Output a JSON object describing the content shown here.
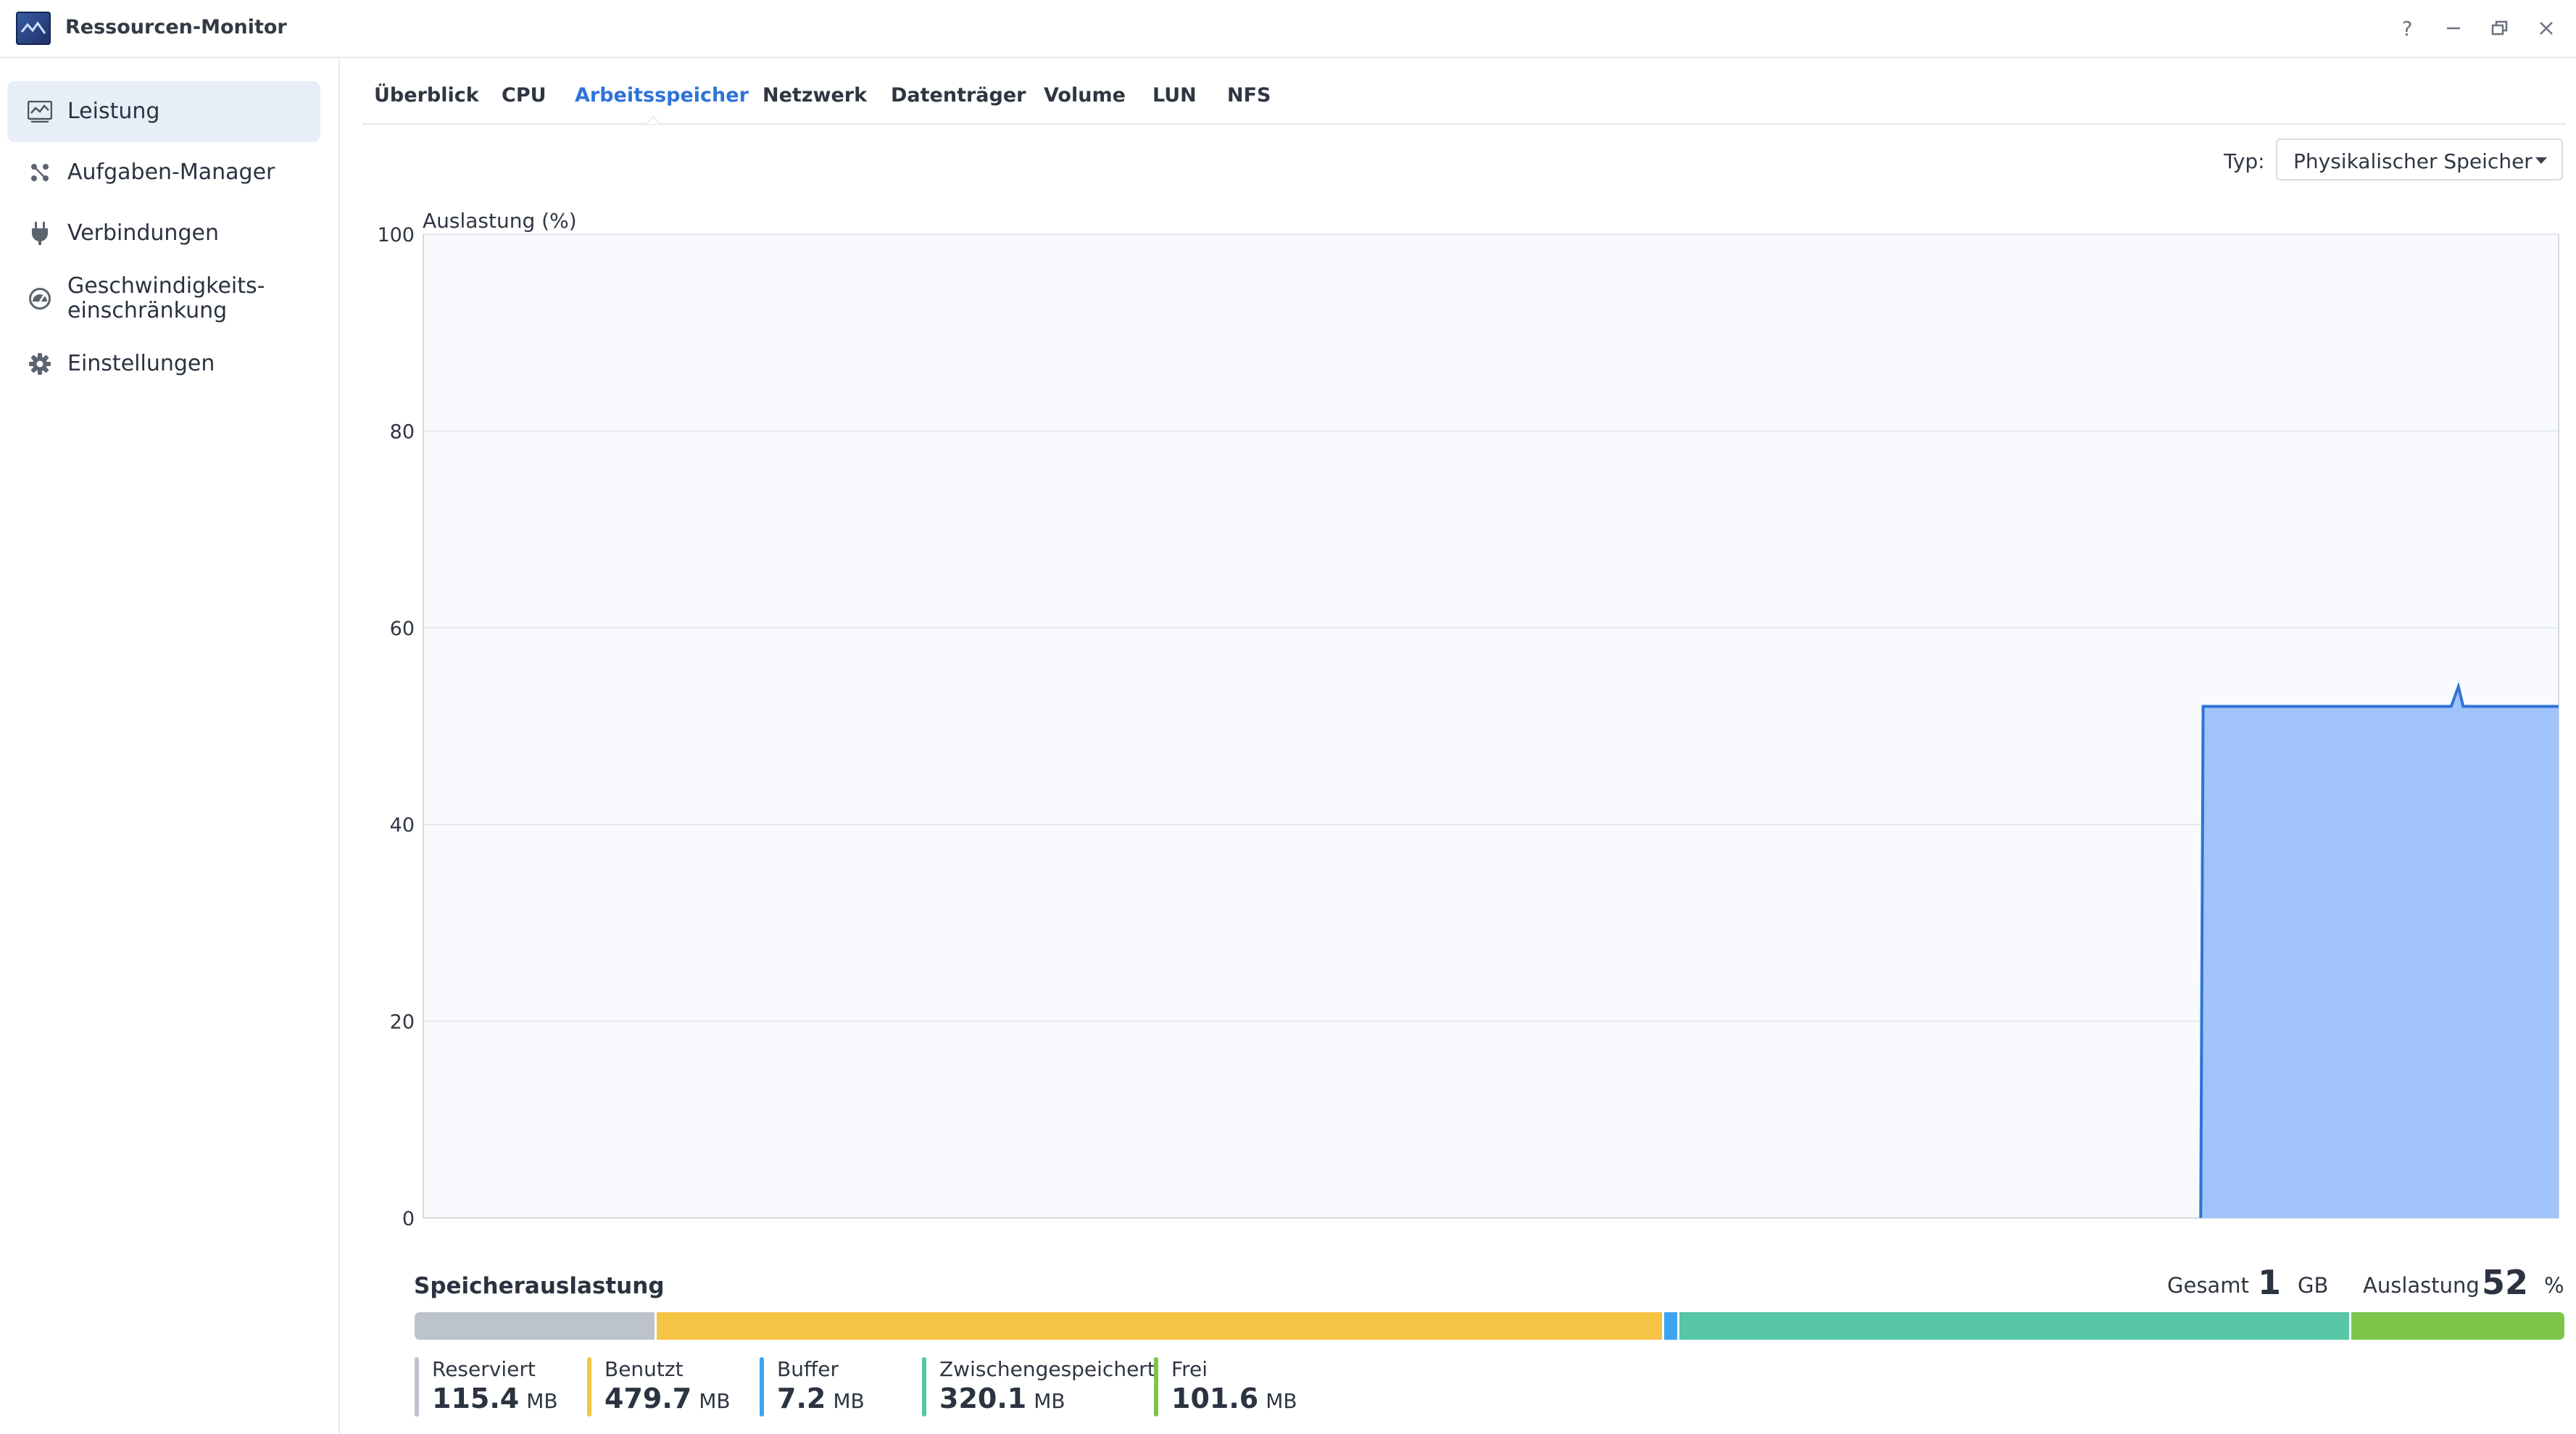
{
  "window": {
    "title": "Ressourcen-Monitor"
  },
  "sidebar": {
    "items": [
      {
        "label": "Leistung",
        "icon": "performance-icon",
        "active": true
      },
      {
        "label": "Aufgaben-Manager",
        "icon": "task-manager-icon"
      },
      {
        "label": "Verbindungen",
        "icon": "plug-icon"
      },
      {
        "label": "Geschwindigkeits-\neinschränkung",
        "icon": "speed-gauge-icon"
      },
      {
        "label": "Einstellungen",
        "icon": "gear-icon"
      }
    ]
  },
  "tabs": [
    {
      "label": "Überblick"
    },
    {
      "label": "CPU"
    },
    {
      "label": "Arbeitsspeicher",
      "active": true
    },
    {
      "label": "Netzwerk"
    },
    {
      "label": "Datenträger"
    },
    {
      "label": "Volume"
    },
    {
      "label": "LUN"
    },
    {
      "label": "NFS"
    }
  ],
  "type_selector": {
    "label": "Typ:",
    "value": "Physikalischer Speicher"
  },
  "chart_data": {
    "type": "area",
    "ylabel": "Auslastung (%)",
    "ylim": [
      0,
      100
    ],
    "yticks": [
      "100",
      "80",
      "60",
      "40",
      "20",
      "0"
    ],
    "grid": true,
    "x_count": 180,
    "series": [
      {
        "color": "#a0c4fa",
        "line_color": "#2f73d8",
        "points": [
          [
            149,
            0
          ],
          [
            149.2,
            52
          ],
          [
            170,
            52
          ],
          [
            170.6,
            54
          ],
          [
            171,
            52
          ],
          [
            179,
            52
          ]
        ]
      }
    ]
  },
  "memory": {
    "title": "Speicherauslastung",
    "total_label": "Gesamt",
    "total_value": "1",
    "total_unit": "GB",
    "util_label": "Auslastung",
    "util_value": "52",
    "util_unit": "%",
    "segments": [
      {
        "name": "Reserviert",
        "value": "115.4",
        "unit": "MB",
        "mb": 115.4,
        "color": "#bcc3cd"
      },
      {
        "name": "Benutzt",
        "value": "479.7",
        "unit": "MB",
        "mb": 479.7,
        "color": "#f6c445"
      },
      {
        "name": "Buffer",
        "value": "7.2",
        "unit": "MB",
        "mb": 7.2,
        "color": "#3ea4f0"
      },
      {
        "name": "Zwischengespeichert",
        "value": "320.1",
        "unit": "MB",
        "mb": 320.1,
        "color": "#56c6a6"
      },
      {
        "name": "Frei",
        "value": "101.6",
        "unit": "MB",
        "mb": 101.6,
        "color": "#7cc54a"
      }
    ]
  }
}
